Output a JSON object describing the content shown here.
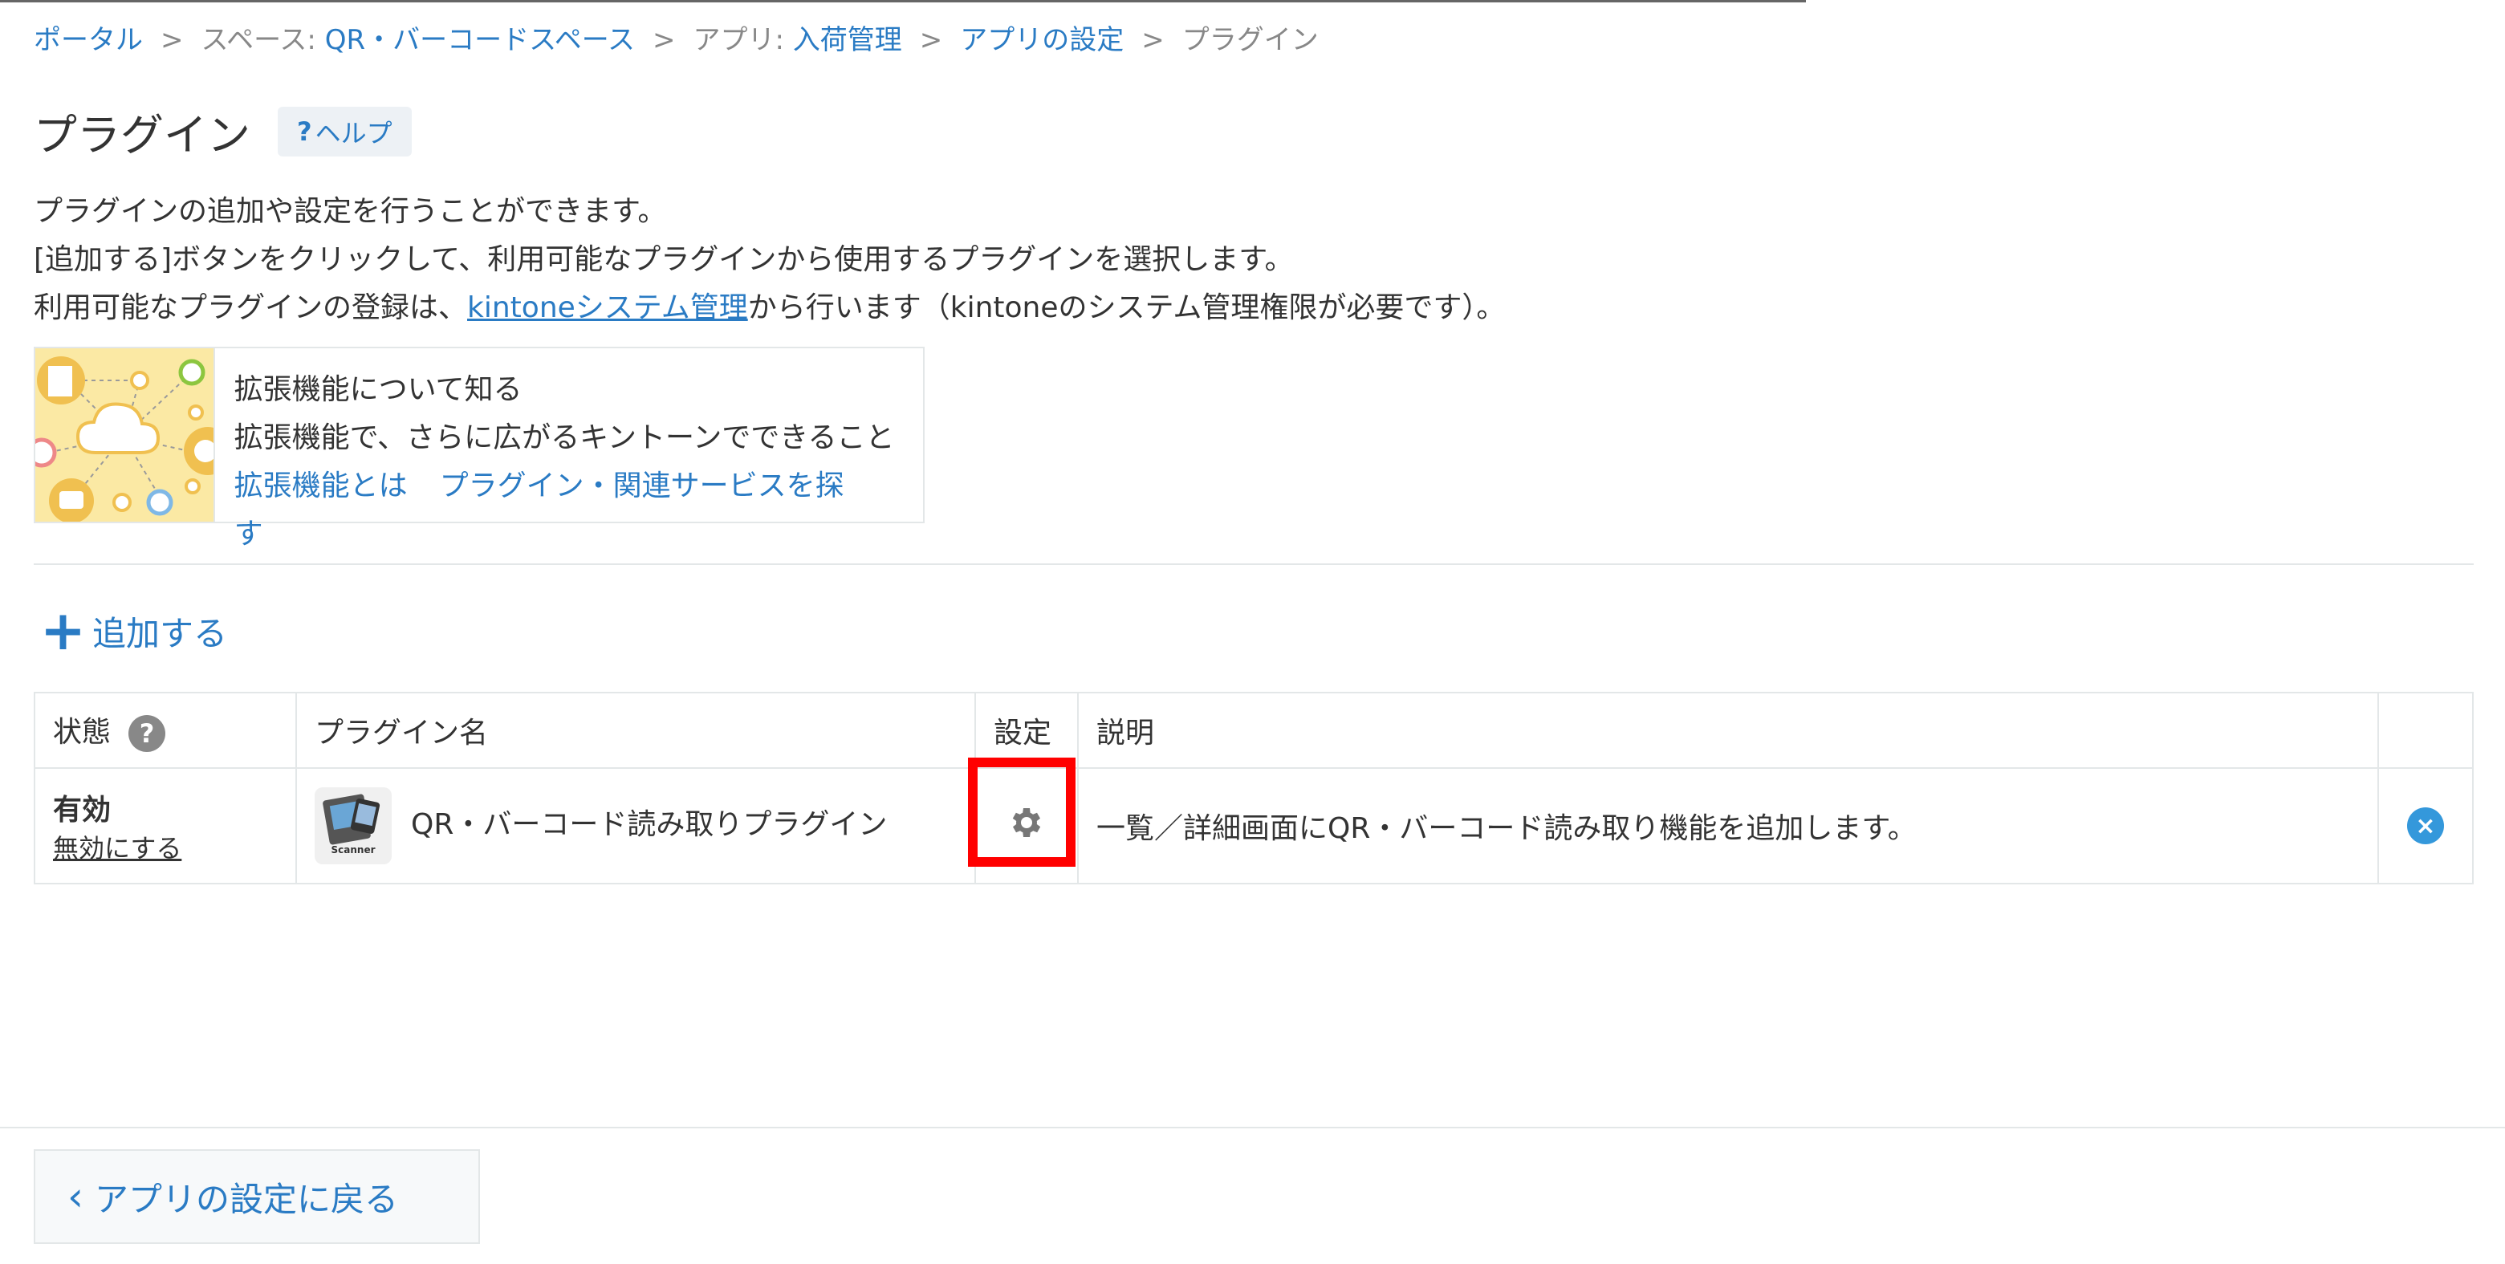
{
  "breadcrumb": {
    "portal": "ポータル",
    "space_prefix": "スペース: ",
    "space": "QR・バーコードスペース",
    "app_prefix": "アプリ: ",
    "app": "入荷管理",
    "settings": "アプリの設定",
    "current": "プラグイン",
    "separator": ">"
  },
  "page": {
    "title": "プラグイン",
    "help_label": "ヘルプ"
  },
  "description": {
    "line1": "プラグインの追加や設定を行うことができます。",
    "line2": "[追加する]ボタンをクリックして、利用可能なプラグインから使用するプラグインを選択します。",
    "line3_prefix": "利用可能なプラグインの登録は、",
    "line3_link": "kintoneシステム管理",
    "line3_suffix": "から行います（kintoneのシステム管理権限が必要です）。"
  },
  "extension_card": {
    "title": "拡張機能について知る",
    "subtitle": "拡張機能で、さらに広がるキントーンでできること",
    "link1": "拡張機能とは",
    "link2": "プラグイン・関連サービスを探す"
  },
  "add_button": {
    "label": "追加する"
  },
  "table": {
    "headers": {
      "status": "状態",
      "name": "プラグイン名",
      "settings": "設定",
      "description": "説明"
    },
    "rows": [
      {
        "status": "有効",
        "toggle_link": "無効にする",
        "name": "QR・バーコード読み取りプラグイン",
        "icon_label": "Scanner",
        "description": "一覧／詳細画面にQR・バーコード読み取り機能を追加します。"
      }
    ]
  },
  "back_button": {
    "label": "アプリの設定に戻る"
  },
  "colors": {
    "link": "#2a7bc4",
    "highlight": "#ff0000",
    "border": "#e3e7e8",
    "delete_icon": "#3498db"
  }
}
